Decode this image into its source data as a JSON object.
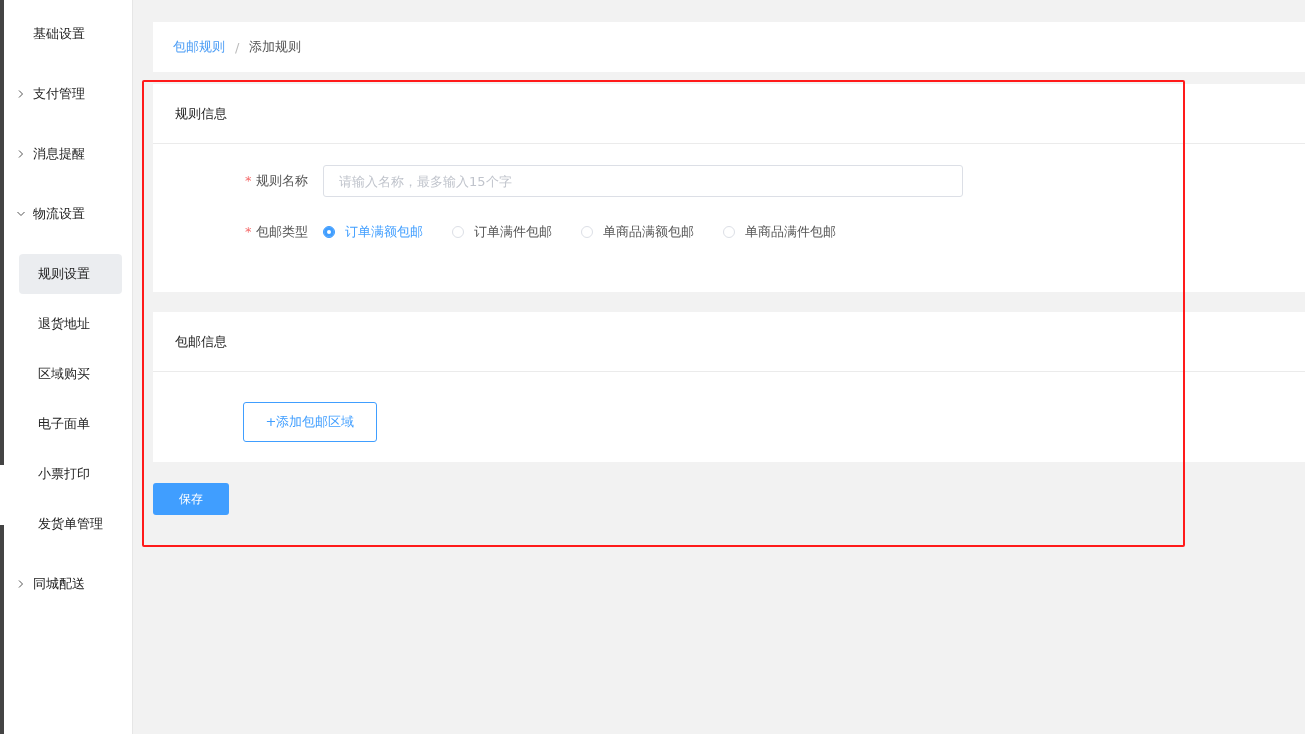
{
  "sidebar": {
    "items": [
      {
        "label": "基础设置",
        "kind": "leaf"
      },
      {
        "label": "支付管理",
        "kind": "group",
        "expanded": false
      },
      {
        "label": "消息提醒",
        "kind": "group",
        "expanded": false
      },
      {
        "label": "物流设置",
        "kind": "group",
        "expanded": true,
        "children": [
          {
            "label": "规则设置",
            "selected": true
          },
          {
            "label": "退货地址",
            "selected": false
          },
          {
            "label": "区域购买",
            "selected": false
          },
          {
            "label": "电子面单",
            "selected": false
          },
          {
            "label": "小票打印",
            "selected": false
          },
          {
            "label": "发货单管理",
            "selected": false
          }
        ]
      },
      {
        "label": "同城配送",
        "kind": "group",
        "expanded": false
      }
    ]
  },
  "breadcrumb": [
    {
      "label": "包邮规则",
      "kind": "link"
    },
    {
      "label": "/",
      "kind": "separator"
    },
    {
      "label": "添加规则",
      "kind": "current"
    }
  ],
  "rule_info": {
    "title": "规则信息",
    "name_field": {
      "label": "规则名称",
      "required_mark": "*",
      "placeholder": "请输入名称，最多输入15个字"
    },
    "type_field": {
      "label": "包邮类型",
      "required_mark": "*",
      "options": [
        {
          "label": "订单满额包邮",
          "selected": true
        },
        {
          "label": "订单满件包邮",
          "selected": false
        },
        {
          "label": "单商品满额包邮",
          "selected": false
        },
        {
          "label": "单商品满件包邮",
          "selected": false
        }
      ]
    }
  },
  "shipping_info": {
    "title": "包邮信息",
    "add_button": "+添加包邮区域"
  },
  "save_button": "保存"
}
